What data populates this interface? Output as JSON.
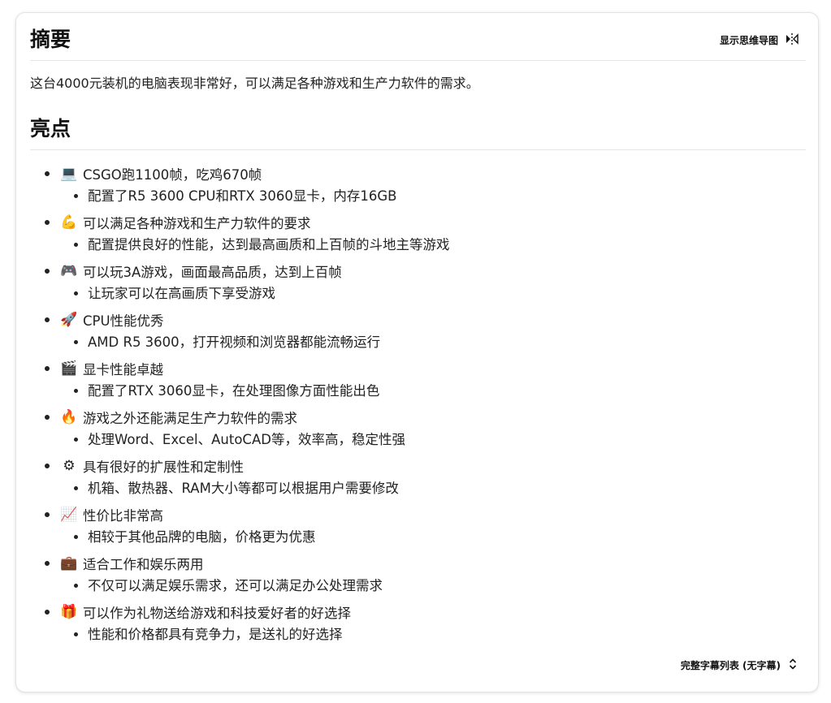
{
  "summary": {
    "heading": "摘要",
    "mindmap_label": "显示思维导图",
    "text": "这台4000元装机的电脑表现非常好，可以满足各种游戏和生产力软件的需求。"
  },
  "highlights": {
    "heading": "亮点",
    "items": [
      {
        "emoji": "💻",
        "icon": "laptop-icon",
        "title": "CSGO跑1100帧，吃鸡670帧",
        "sub": "配置了R5 3600 CPU和RTX 3060显卡，内存16GB"
      },
      {
        "emoji": "💪",
        "icon": "flexed-biceps-icon",
        "title": "可以满足各种游戏和生产力软件的要求",
        "sub": "配置提供良好的性能，达到最高画质和上百帧的斗地主等游戏"
      },
      {
        "emoji": "🎮",
        "icon": "game-controller-icon",
        "title": "可以玩3A游戏，画面最高品质，达到上百帧",
        "sub": "让玩家可以在高画质下享受游戏"
      },
      {
        "emoji": "🚀",
        "icon": "rocket-icon",
        "title": "CPU性能优秀",
        "sub": "AMD R5 3600，打开视频和浏览器都能流畅运行"
      },
      {
        "emoji": "🎬",
        "icon": "clapper-board-icon",
        "title": "显卡性能卓越",
        "sub": "配置了RTX 3060显卡，在处理图像方面性能出色"
      },
      {
        "emoji": "🔥",
        "icon": "fire-icon",
        "title": "游戏之外还能满足生产力软件的需求",
        "sub": "处理Word、Excel、AutoCAD等，效率高，稳定性强"
      },
      {
        "emoji": "⚙",
        "icon": "gear-icon",
        "title": "具有很好的扩展性和定制性",
        "sub": "机箱、散热器、RAM大小等都可以根据用户需要修改"
      },
      {
        "emoji": "📈",
        "icon": "chart-increasing-icon",
        "title": "性价比非常高",
        "sub": "相较于其他品牌的电脑，价格更为优惠"
      },
      {
        "emoji": "💼",
        "icon": "briefcase-icon",
        "title": "适合工作和娱乐两用",
        "sub": "不仅可以满足娱乐需求，还可以满足办公处理需求"
      },
      {
        "emoji": "🎁",
        "icon": "gift-icon",
        "title": "可以作为礼物送给游戏和科技爱好者的好选择",
        "sub": "性能和价格都具有竞争力，是送礼的好选择"
      }
    ]
  },
  "footer": {
    "transcript_label": "完整字幕列表 (无字幕)"
  }
}
